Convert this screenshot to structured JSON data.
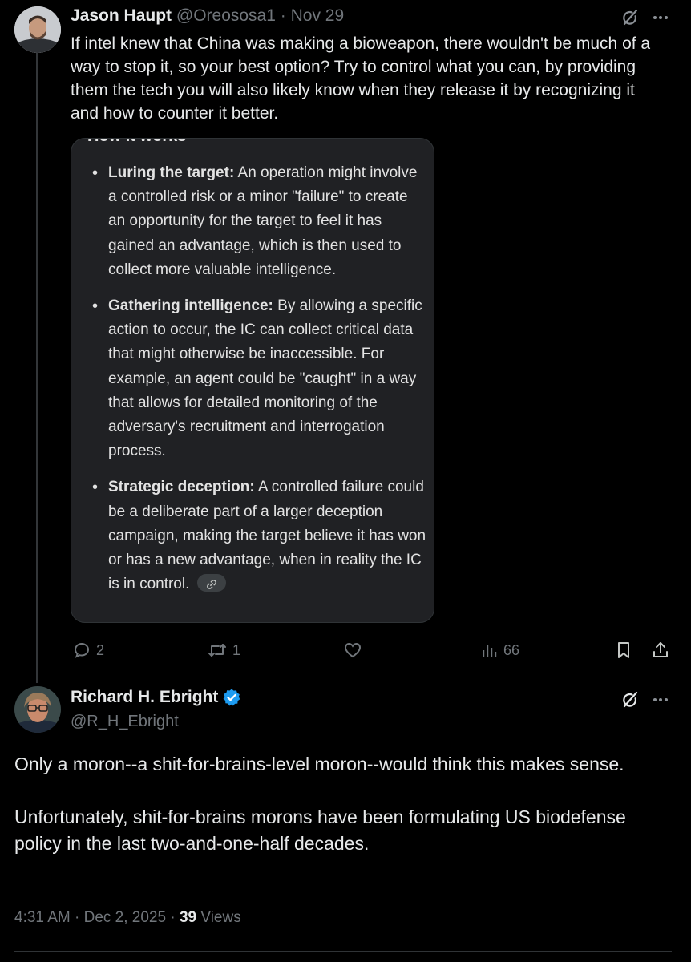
{
  "tweet1": {
    "name": "Jason Haupt",
    "handle": "@Oreososa1",
    "sep": "·",
    "date": "Nov 29",
    "text": "If intel knew that China was making a bioweapon, there wouldn't be much of a way to stop it, so your best option? Try to control what you can, by providing them the tech you will also likely know when they release it by recognizing it and how to counter it better.",
    "quote": {
      "heading": "How it works",
      "items": [
        {
          "title": "Luring the target:",
          "body": "An operation might involve a controlled risk or a minor \"failure\" to create an opportunity for the target to feel it has gained an advantage, which is then used to collect more valuable intelligence."
        },
        {
          "title": "Gathering intelligence:",
          "body": "By allowing a specific action to occur, the IC can collect critical data that might otherwise be inaccessible. For example, an agent could be \"caught\" in a way that allows for detailed monitoring of the adversary's recruitment and interrogation process."
        },
        {
          "title": "Strategic deception:",
          "body": "A controlled failure could be a deliberate part of a larger deception campaign, making the target believe it has won or has a new advantage, when in reality the IC is in control."
        }
      ]
    },
    "actions": {
      "replies": "2",
      "reposts": "1",
      "likes": "",
      "views": "66"
    }
  },
  "tweet2": {
    "name": "Richard H. Ebright",
    "handle": "@R_H_Ebright",
    "paragraphs": [
      "Only a moron--a shit-for-brains-level moron--would think this makes sense.",
      "Unfortunately, shit-for-brains morons have been formulating US biodefense policy in the last two-and-one-half decades."
    ],
    "time": "4:31 AM · Dec 2, 2025 ·",
    "views_count": "39",
    "views_label": "Views"
  },
  "icons": {
    "grok": "grok-icon",
    "more": "more-icon",
    "reply": "reply-icon",
    "repost": "repost-icon",
    "like": "heart-icon",
    "views": "views-icon",
    "bookmark": "bookmark-icon",
    "share": "share-icon",
    "verified": "verified-badge-icon",
    "link": "link-icon"
  },
  "colors": {
    "background": "#000000",
    "text": "#e7e9ea",
    "muted": "#71767b",
    "card": "#202124",
    "verified": "#1d9bf0"
  }
}
